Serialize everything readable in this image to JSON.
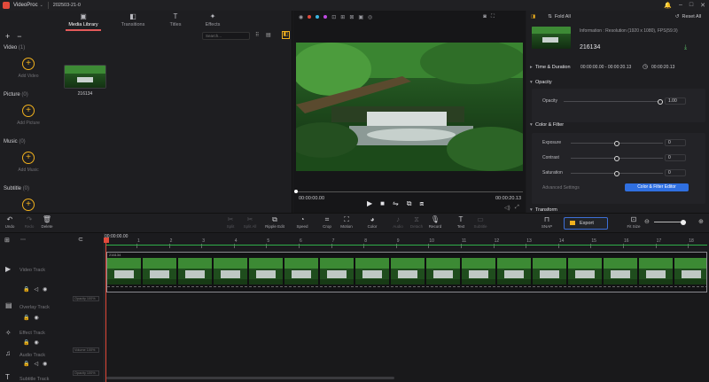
{
  "titlebar": {
    "app": "VideoProc",
    "project": "202503-21-0"
  },
  "left": {
    "tabs": [
      "Media Library",
      "Transitions",
      "Titles",
      "Effects"
    ],
    "search_placeholder": "Search...",
    "categories": [
      {
        "name": "Video",
        "count": "(1)",
        "add": "Add Video"
      },
      {
        "name": "Picture",
        "count": "(0)",
        "add": "Add Picture"
      },
      {
        "name": "Music",
        "count": "(0)",
        "add": "Add Music"
      },
      {
        "name": "Subtitle",
        "count": "(0)",
        "add": "Add Subtitle"
      }
    ],
    "clip_name": "216134"
  },
  "preview": {
    "time_current": "00:00:00.00",
    "time_total": "00:00:20.13"
  },
  "right": {
    "fold_all": "Fold All",
    "reset_all": "Reset All",
    "info": "Information : Resolution (1920 x 1080), FPS(59.9)",
    "clip_name": "216134",
    "time_label": "Time & Duration",
    "time_range": "00:00:00.00 - 00:00:20.13",
    "duration": "00:00:20.13",
    "opacity_section": "Opacity",
    "opacity_label": "Opacity",
    "opacity_value": "1.00",
    "opacity_level": 1.0,
    "color_section": "Color & Filter",
    "exposure_label": "Exposure",
    "exposure_value": "0",
    "contrast_label": "Contrast",
    "contrast_value": "0",
    "saturation_label": "Saturation",
    "saturation_value": "0",
    "advanced": "Advanced Settings",
    "filter_btn": "Color & Filter Editor",
    "transform": "Transform"
  },
  "toolbar": {
    "undo": "Undo",
    "redo": "Redo",
    "delete": "Delete",
    "split": "Split",
    "split_all": "Split All",
    "ripple": "Ripple Edit",
    "speed": "Speed",
    "crop": "Crop",
    "motion": "Motion",
    "color": "Color",
    "audio": "Audio",
    "detach": "Detach",
    "record": "Record",
    "text": "Text",
    "subtitle": "Subtitle",
    "snap": "SNAP",
    "export": "Export",
    "fit": "Fit Size"
  },
  "timeline": {
    "time": "00:00:00.00",
    "ticks": [
      "1",
      "2",
      "3",
      "4",
      "5",
      "6",
      "7",
      "8",
      "9",
      "10",
      "11",
      "12",
      "13",
      "14",
      "15",
      "16",
      "17",
      "18"
    ],
    "clip_label": "216134",
    "tracks": [
      {
        "name": "Video Track",
        "opacity": ""
      },
      {
        "name": "Overlay Track",
        "opacity": "Opacity 100%"
      },
      {
        "name": "Effect Track",
        "opacity": ""
      },
      {
        "name": "Audio Track",
        "opacity": "Volume 100%"
      },
      {
        "name": "Subtitle Track",
        "opacity": "Opacity 100%"
      }
    ]
  }
}
